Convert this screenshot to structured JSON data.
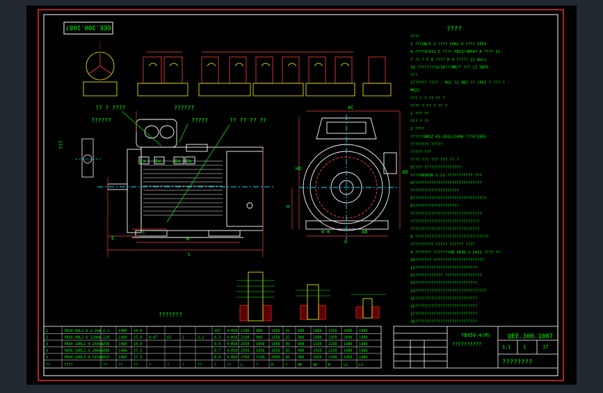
{
  "colors": {
    "background": "#212830",
    "sheet": "#000000",
    "border": "#ff3030",
    "frame": "#ffffff",
    "text": "#00ff00",
    "dim": "#ff4040",
    "center": "#00e5ff",
    "hatch": "#ff2020",
    "detail": "#ffff00",
    "body": "#ffffff"
  },
  "drawing": {
    "number_rotated": "QEE.300.1087",
    "title_main": "????",
    "name_callout": "??????",
    "terminal_box_label": "?? ? ????",
    "junction_label": "?????",
    "fan_label": "??????",
    "cable_label": "?? ?? ?? ??",
    "dim_ab": "???",
    "markings": [
      "Ex",
      "Ex",
      "Ex",
      "Ex"
    ],
    "dims": {
      "L": "L",
      "B": "B",
      "A": "A",
      "AD": "AD",
      "HD": "HD",
      "H": "H",
      "AC": "AC",
      "K": "4-K",
      "D": "D",
      "E": "E",
      "F": "F",
      "C": "C",
      "AB": "AB"
    },
    "table_caption": "???????"
  },
  "notes": {
    "lines": [
      "????",
      "1 ???UN/V  2 ????  50Hz  3 ????  IP55",
      "4 ????IC411 5 ???? YBX3/YBX4T 6 ????  S1",
      "7 ?? ? F 8 ????  H 9 ????? 22.8m/s",
      "10 ????????3/3A???MB/T  ??? LI OBF6",
      "???",
      "1?????? ???? : M22 ?2-4B2 ?? /P61  ? ??? ? :",
      "M022",
      "??? ? ? ?? ?? ?",
      "???? ? ?? ? ?? ?",
      "1 ??? ??",
      "??? ? ??",
      "2 ????",
      "??????DM2Z-03-2012/2008 ???0?2001",
      "???????? ?????",
      "????? ???",
      "???? ??? ??? ??? ?? ?",
      "3???? ????????????????",
      "????GB3836.2-11 ??????????? ???",
      "4??????????????????????????????",
      "?????????????????????",
      "5????????????????????????????????",
      "6????????????????????",
      "7??????????????????????????????",
      "  ??????????????????????????????",
      "  ??????????????????????????????",
      "8 ????????????????????????????????",
      "  ?????????? ????? ?????? ????",
      "9 ??????? ???????GB 3836.2-2021 ???? ??",
      "10??????? ??????????????????????",
      "11???????????????????????????",
      "12???????????? ????????????????",
      "13???????????????????????????",
      "14???????????????????????????????",
      "15???????????????????????????",
      "16???????????????????????????",
      "17???????????????????????????",
      "18???????????????????????????"
    ]
  },
  "data_table": {
    "rows": [
      [
        "1",
        "YBX4-90L2-6  2.2kW",
        "2.2",
        "1480",
        "14.0",
        "",
        "",
        "",
        "",
        "107",
        "4-M16",
        "2180",
        "900",
        "1658",
        "25",
        "980",
        "1888",
        "1950",
        "2090",
        "1980"
      ],
      [
        "2",
        "YBX4-90L2-6  220kW",
        "220",
        "1480",
        "15.0",
        "0.87",
        "b5",
        "1",
        "3.2",
        "9.3",
        "4-M16",
        "2180",
        "900",
        "1658",
        "25",
        "980",
        "1888",
        "1950",
        "2090",
        "1980"
      ],
      [
        "3",
        "YBX4-100L1-4  250kW",
        "250",
        "1480",
        "16.0",
        "",
        "",
        "",
        "",
        "9.5",
        "4-M20",
        "2550",
        "1058",
        "1658",
        "30",
        "980",
        "1920",
        "2230",
        "1980",
        "1980"
      ],
      [
        "4",
        "YBX4-100L2-4  280kW",
        "280",
        "1480",
        "17.5",
        "",
        "",
        "",
        "",
        "9.7",
        "4-M20",
        "2550",
        "1058",
        "1658",
        "30",
        "980",
        "1920",
        "2230",
        "1980",
        "1980"
      ],
      [
        "5",
        "YBX4-100L3-4  315kW",
        "315",
        "1485",
        "17.5",
        "",
        "",
        "",
        "",
        "8.6",
        "4-M20",
        "2760",
        "1150",
        "2050",
        "30",
        "980",
        "1920",
        "2760",
        "1980",
        "1980"
      ]
    ],
    "header": [
      "??",
      "????",
      "??",
      "??",
      "??",
      "?",
      "?",
      "?",
      "??",
      "?",
      "??",
      "L",
      "?",
      "H",
      "?",
      "HD",
      "AD",
      "B",
      "L1",
      "L2"
    ]
  },
  "title_block": {
    "model": "YBX50-4(M)",
    "doc_number": "QEE.300.1087",
    "name_line": "??????????",
    "company": "????????",
    "scale": "1:1",
    "sheet_count": "17",
    "sheet_no": "1"
  }
}
